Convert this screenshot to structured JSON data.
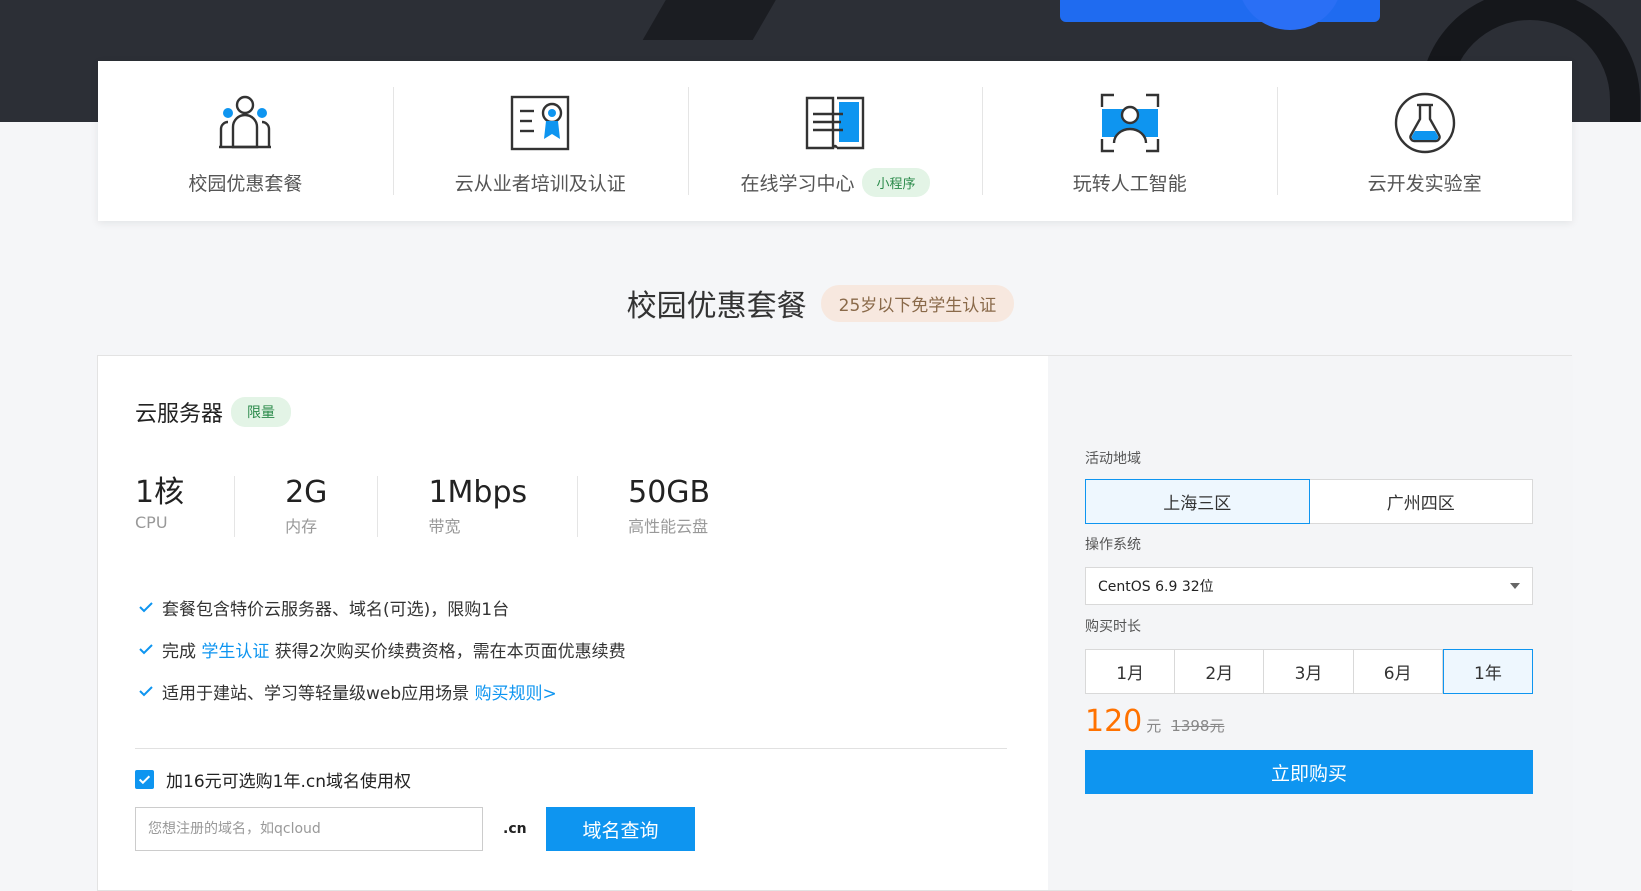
{
  "nav": {
    "items": [
      {
        "label": "校园优惠套餐",
        "icon": "campus-package-icon"
      },
      {
        "label": "云从业者培训及认证",
        "icon": "certificate-icon"
      },
      {
        "label": "在线学习中心",
        "icon": "book-icon",
        "badge": "小程序"
      },
      {
        "label": "玩转人工智能",
        "icon": "face-scan-icon"
      },
      {
        "label": "云开发实验室",
        "icon": "flask-icon"
      }
    ]
  },
  "section": {
    "title": "校园优惠套餐",
    "badge": "25岁以下免学生认证"
  },
  "product": {
    "title": "云服务器",
    "badge": "限量",
    "specs": [
      {
        "value": "1核",
        "label": "CPU"
      },
      {
        "value": "2G",
        "label": "内存"
      },
      {
        "value": "1Mbps",
        "label": "带宽"
      },
      {
        "value": "50GB",
        "label": "高性能云盘"
      }
    ],
    "features": {
      "f1": "套餐包含特价云服务器、域名(可选)，限购1台",
      "f2_pre": "完成 ",
      "f2_link": "学生认证",
      "f2_post": " 获得2次购买价续费资格，需在本页面优惠续费",
      "f3_pre": "适用于建站、学习等轻量级web应用场景 ",
      "f3_link": "购买规则>"
    },
    "domain": {
      "option_label": "加16元可选购1年.cn域名使用权",
      "checked": true,
      "placeholder": "您想注册的域名，如qcloud",
      "suffix": ".cn",
      "button": "域名查询"
    }
  },
  "order": {
    "region_label": "活动地域",
    "regions": [
      "上海三区",
      "广州四区"
    ],
    "selected_region": "上海三区",
    "os_label": "操作系统",
    "os_value": "CentOS 6.9 32位",
    "duration_label": "购买时长",
    "durations": [
      "1月",
      "2月",
      "3月",
      "6月",
      "1年"
    ],
    "selected_duration": "1年",
    "price": "120",
    "price_unit": "元",
    "old_price": "1398元",
    "buy_button": "立即购买"
  },
  "colors": {
    "accent": "#0e95f0",
    "price": "#ff7200",
    "badge_green_bg": "#e3f4e6",
    "badge_orange_bg": "#f7e8df"
  }
}
